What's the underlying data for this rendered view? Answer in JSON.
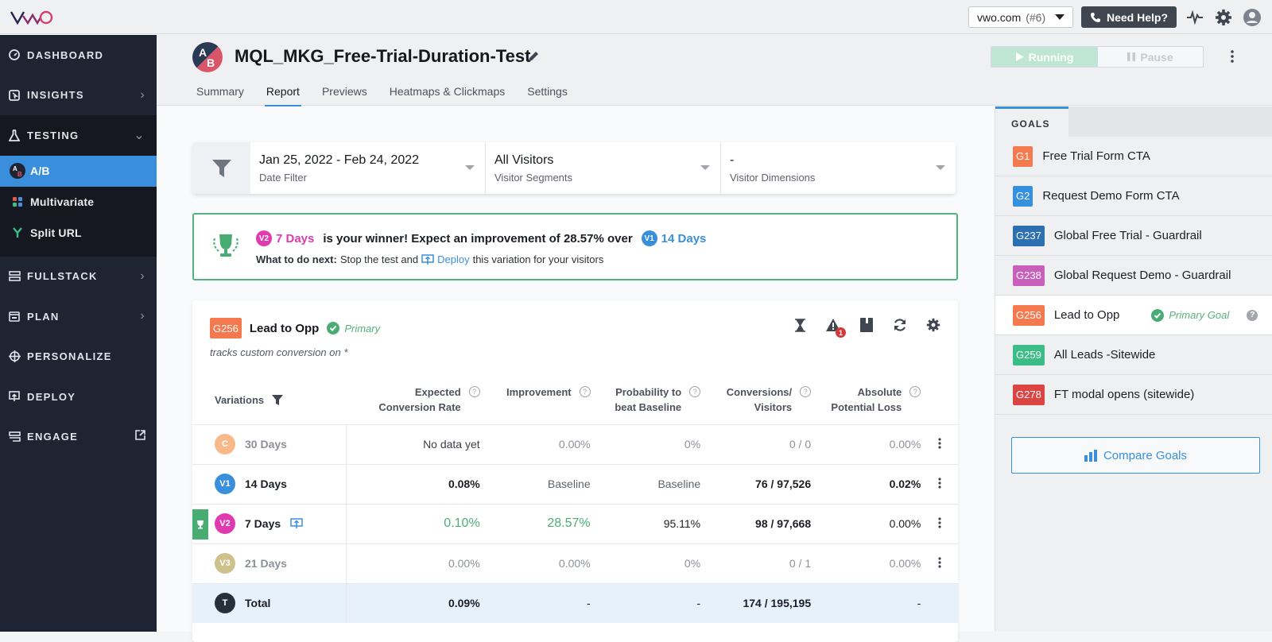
{
  "topbar": {
    "logo": "VWO",
    "account": {
      "name": "vwo.com",
      "id": "(#6)"
    },
    "help_label": "Need Help?",
    "icons": [
      "activity-icon",
      "gear-icon",
      "user-avatar-icon"
    ]
  },
  "sidebar": {
    "items": [
      {
        "label": "DASHBOARD",
        "icon": "dashboard-icon",
        "chevron": false
      },
      {
        "label": "INSIGHTS",
        "icon": "insights-icon",
        "chevron": true
      },
      {
        "label": "TESTING",
        "icon": "flask-icon",
        "chevron": true,
        "expanded": true
      },
      {
        "label": "FULLSTACK",
        "icon": "fullstack-icon",
        "chevron": true
      },
      {
        "label": "PLAN",
        "icon": "calendar-icon",
        "chevron": true
      },
      {
        "label": "PERSONALIZE",
        "icon": "crosshair-icon",
        "chevron": false
      },
      {
        "label": "DEPLOY",
        "icon": "deploy-icon",
        "chevron": false
      },
      {
        "label": "ENGAGE",
        "icon": "engage-icon",
        "external": true
      }
    ],
    "testing_sub": [
      {
        "label": "A/B",
        "active": true
      },
      {
        "label": "Multivariate"
      },
      {
        "label": "Split URL"
      }
    ]
  },
  "header": {
    "title": "MQL_MKG_Free-Trial-Duration-Test",
    "tabs": [
      "Summary",
      "Report",
      "Previews",
      "Heatmaps & Clickmaps",
      "Settings"
    ],
    "active_tab": "Report",
    "running_label": "Running",
    "pause_label": "Pause"
  },
  "filters": {
    "date": {
      "value": "Jan 25, 2022 - Feb 24, 2022",
      "label": "Date Filter"
    },
    "segments": {
      "value": "All Visitors",
      "label": "Visitor Segments"
    },
    "dimensions": {
      "value": "-",
      "label": "Visitor Dimensions"
    }
  },
  "winner": {
    "winner_badge": "V2",
    "winner_name": "7 Days",
    "text": "is your winner! Expect an improvement of 28.57% over",
    "baseline_badge": "V1",
    "baseline_name": "14 Days",
    "next_label": "What to do next:",
    "next_text_1": "Stop the test and",
    "deploy_link": "Deploy",
    "next_text_2": "this variation for your visitors"
  },
  "goal_card": {
    "tag": "G256",
    "name": "Lead to Opp",
    "primary_label": "Primary",
    "tracks": "tracks custom conversion on *",
    "alert_count": "1",
    "columns": {
      "variations": "Variations",
      "ecr_1": "Expected",
      "ecr_2": "Conversion Rate",
      "imp": "Improvement",
      "prob_1": "Probability to",
      "prob_2": "beat Baseline",
      "conv_1": "Conversions/",
      "conv_2": "Visitors",
      "loss_1": "Absolute",
      "loss_2": "Potential Loss"
    },
    "rows": [
      {
        "badge": "C",
        "name": "30 Days",
        "color": "#f7b98a",
        "ecr": "No data yet",
        "imp": "0.00%",
        "prob": "0%",
        "conv": "0 / 0",
        "loss": "0.00%"
      },
      {
        "badge": "V1",
        "name": "14 Days",
        "color": "#3a8fdd",
        "ecr": "0.08%",
        "imp": "Baseline",
        "prob": "Baseline",
        "conv": "76 / 97,526",
        "loss": "0.02%"
      },
      {
        "badge": "V2",
        "name": "7 Days",
        "color": "#e03ab0",
        "ecr": "0.10%",
        "imp": "28.57%",
        "prob": "95.11%",
        "conv": "98 / 97,668",
        "loss": "0.00%"
      },
      {
        "badge": "V3",
        "name": "21 Days",
        "color": "#cfc18c",
        "ecr": "0.00%",
        "imp": "0.00%",
        "prob": "0%",
        "conv": "0 / 1",
        "loss": "0.00%"
      }
    ],
    "total": {
      "badge": "T",
      "name": "Total",
      "ecr": "0.09%",
      "imp": "-",
      "prob": "-",
      "conv": "174 / 195,195",
      "loss": "-"
    }
  },
  "goals_panel": {
    "tab_label": "GOALS",
    "items": [
      {
        "tag": "G1",
        "name": "Free Trial Form CTA",
        "color": "#f5794e"
      },
      {
        "tag": "G2",
        "name": "Request Demo Form CTA",
        "color": "#3690e0"
      },
      {
        "tag": "G237",
        "name": "Global Free Trial - Guardrail",
        "color": "#2c70b2"
      },
      {
        "tag": "G238",
        "name": "Global Request Demo - Guardrail",
        "color": "#c85fba"
      },
      {
        "tag": "G256",
        "name": "Lead to Opp",
        "color": "#f5794e",
        "primary": "Primary Goal"
      },
      {
        "tag": "G259",
        "name": "All Leads -Sitewide",
        "color": "#3cbc86"
      },
      {
        "tag": "G278",
        "name": "FT modal opens (sitewide)",
        "color": "#dc4343"
      }
    ],
    "compare_label": "Compare Goals"
  },
  "colors": {
    "accent": "#3a8fdd",
    "success": "#4caf78",
    "sidebar": "#1f2433"
  }
}
